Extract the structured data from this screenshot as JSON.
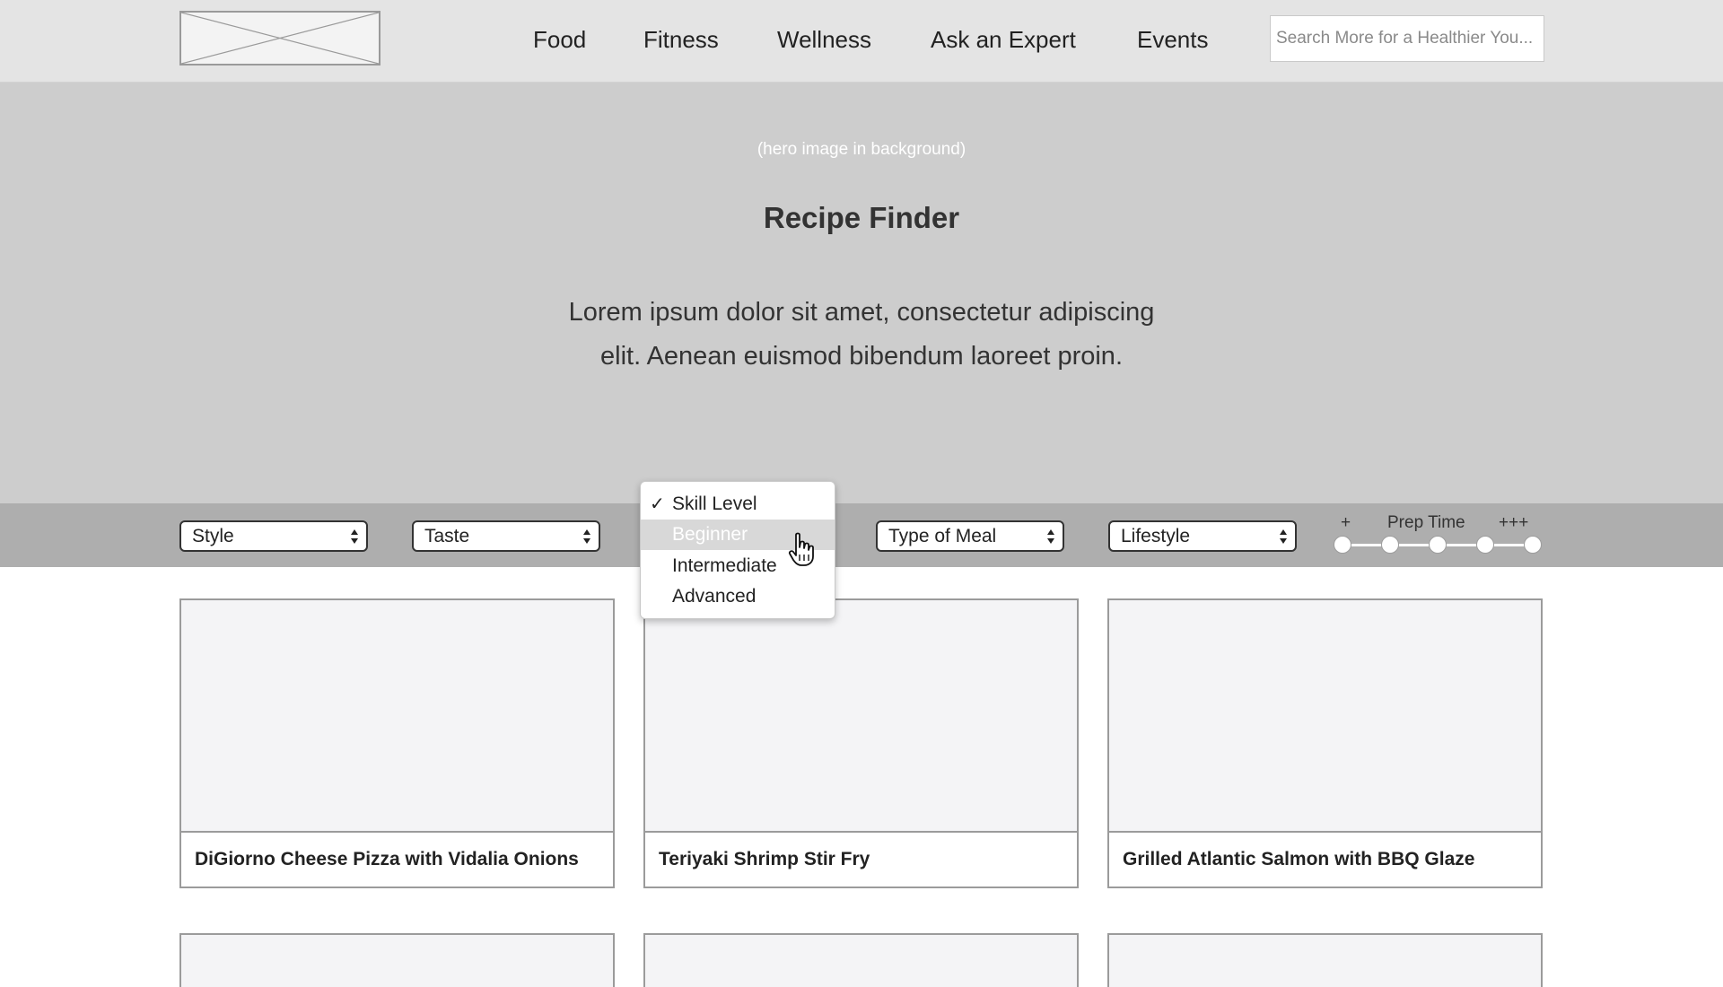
{
  "header": {
    "logo_alt": "logo placeholder",
    "nav": [
      "Food",
      "Fitness",
      "Wellness",
      "Ask an Expert",
      "Events"
    ],
    "search_placeholder": "Search More for a Healthier You..."
  },
  "hero": {
    "note": "(hero image in background)",
    "title": "Recipe Finder",
    "description": "Lorem ipsum dolor sit amet, consectetur adipiscing elit. Aenean euismod bibendum laoreet proin."
  },
  "filters": {
    "style": "Style",
    "taste": "Taste",
    "type_of_meal": "Type of Meal",
    "lifestyle": "Lifestyle",
    "prep_time": {
      "label": "Prep Time",
      "min_label": "+",
      "max_label": "+++",
      "steps": 5
    }
  },
  "skill_dropdown": {
    "check_glyph": "✓",
    "selected": "Skill Level",
    "highlighted": "Beginner",
    "options": [
      "Skill Level",
      "Beginner",
      "Intermediate",
      "Advanced"
    ]
  },
  "recipes": [
    {
      "title": "DiGiorno Cheese Pizza with Vidalia Onions"
    },
    {
      "title": "Teriyaki Shrimp Stir Fry"
    },
    {
      "title": "Grilled Atlantic Salmon with BBQ Glaze"
    }
  ],
  "colors": {
    "header_bg": "#e4e4e4",
    "hero_bg": "#cdcdcd",
    "filterbar_bg": "#aeaeae",
    "card_image_bg": "#f4f4f6",
    "highlight": "#d8d8d8"
  }
}
